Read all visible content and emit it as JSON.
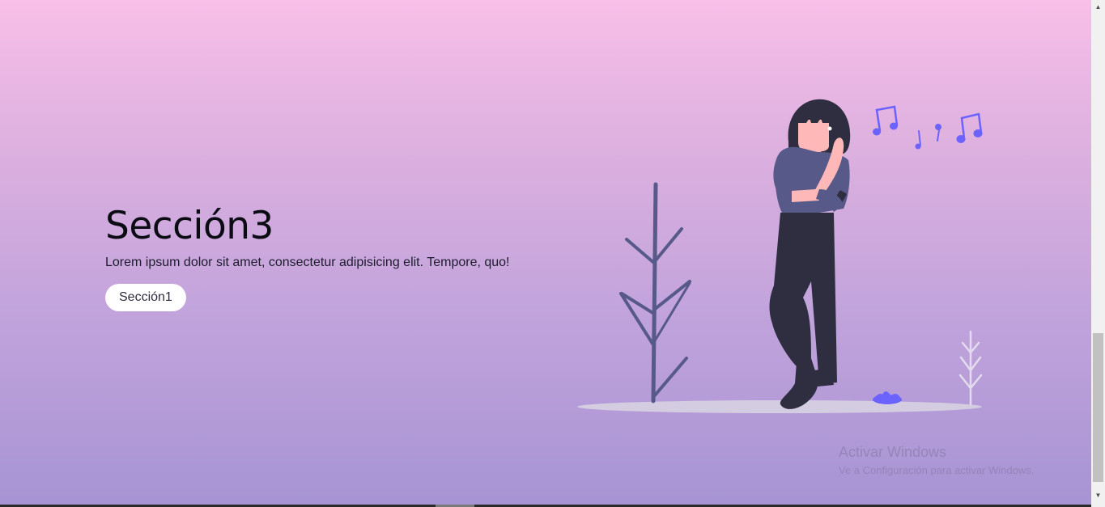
{
  "section": {
    "title": "Sección3",
    "description": "Lorem ipsum dolor sit amet, consectetur adipisicing elit. Tempore, quo!",
    "button_label": "Sección1"
  },
  "illustration": {
    "name": "woman-listening-to-music",
    "icons": [
      "music-note-icon",
      "plant-icon",
      "flower-icon"
    ]
  },
  "watermark": {
    "title": "Activar Windows",
    "subtitle": "Ve a Configuración para activar Windows."
  },
  "colors": {
    "gradient_top": "#f8bfe8",
    "gradient_bottom": "#a794d4",
    "accent": "#6c63ff",
    "dark": "#2f2e41",
    "shirt": "#575a89",
    "skin": "#ffb8b8"
  }
}
